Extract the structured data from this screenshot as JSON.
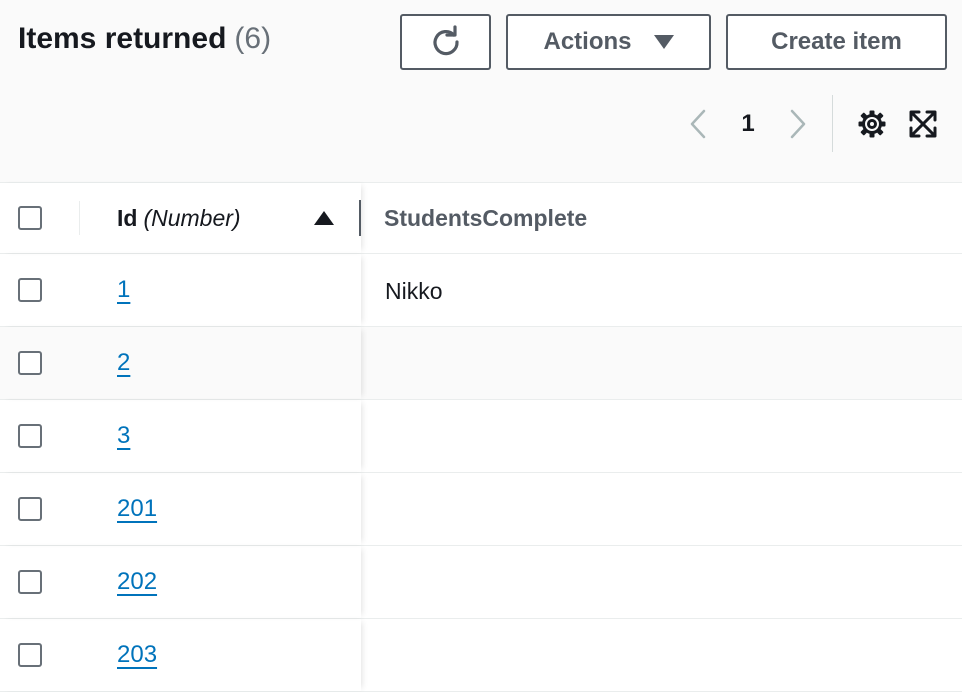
{
  "header": {
    "title": "Items returned",
    "count": "(6)",
    "actions_label": "Actions",
    "create_label": "Create item"
  },
  "pagination": {
    "current_page": "1"
  },
  "icons": {
    "refresh": "refresh-icon",
    "prev": "chevron-left-icon",
    "next": "chevron-right-icon",
    "settings": "gear-icon",
    "fullscreen": "fullscreen-icon",
    "sort": "sort-ascending-icon"
  },
  "table": {
    "columns": [
      {
        "name": "Id",
        "type": "(Number)"
      },
      {
        "name": "StudentsComplete"
      }
    ],
    "rows": [
      {
        "id": "1",
        "students_complete": "Nikko"
      },
      {
        "id": "2",
        "students_complete": ""
      },
      {
        "id": "3",
        "students_complete": ""
      },
      {
        "id": "201",
        "students_complete": ""
      },
      {
        "id": "202",
        "students_complete": ""
      },
      {
        "id": "203",
        "students_complete": ""
      }
    ]
  },
  "colors": {
    "link": "#0073bb",
    "text": "#16191f",
    "secondary": "#545b64"
  }
}
